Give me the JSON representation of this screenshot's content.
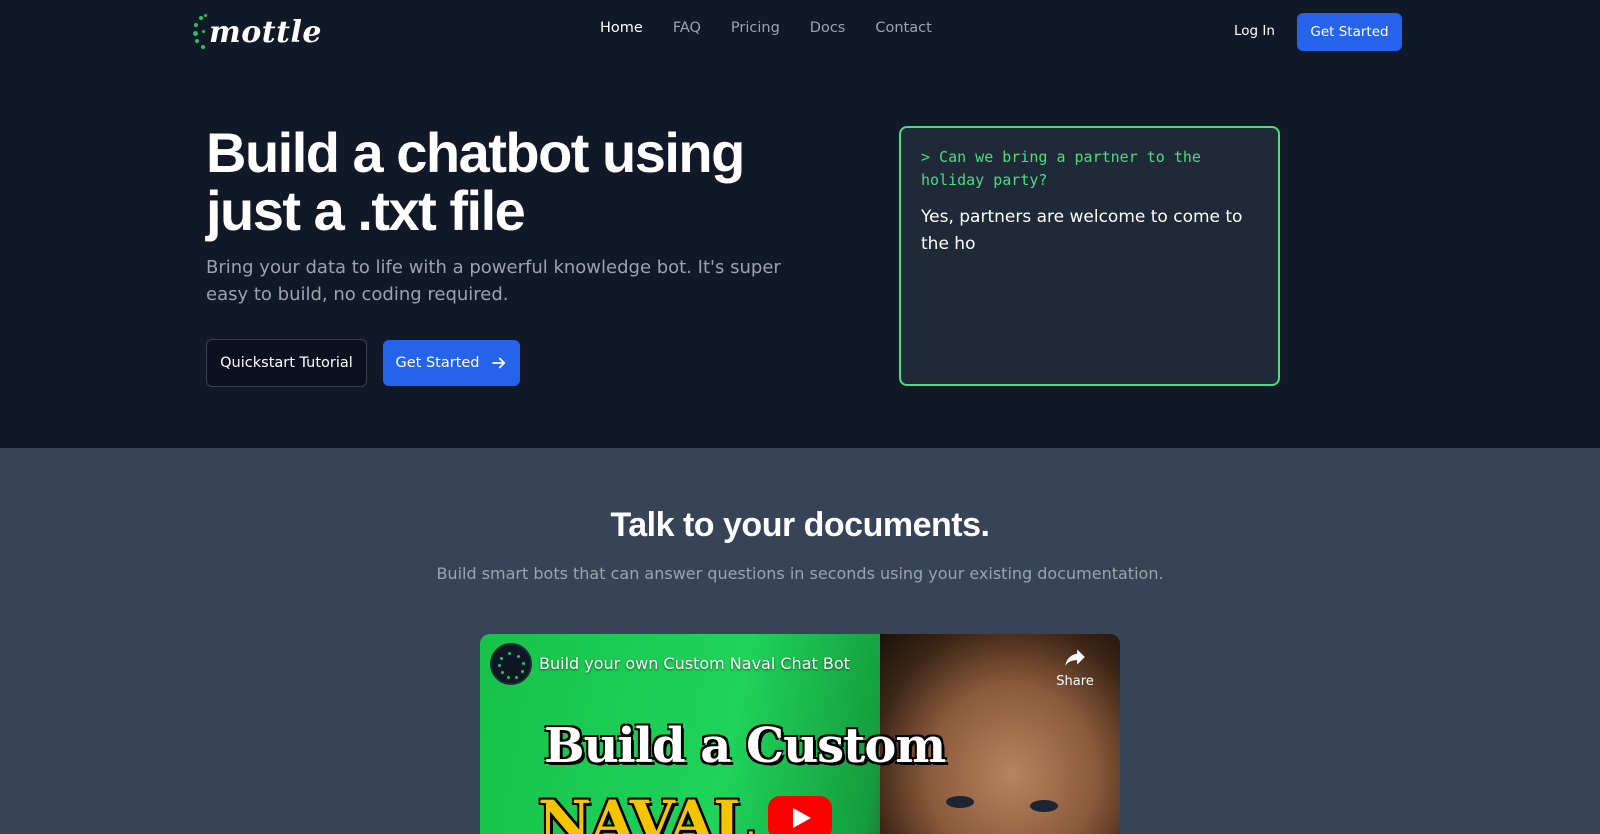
{
  "brand": {
    "name": "mottle",
    "accent": "#22c55e",
    "primary": "#2563eb"
  },
  "nav": {
    "links": [
      "Home",
      "FAQ",
      "Pricing",
      "Docs",
      "Contact"
    ],
    "active": "Home",
    "login": "Log In",
    "cta": "Get Started"
  },
  "hero": {
    "title": "Build a chatbot using just a .txt file",
    "subtitle": "Bring your data to life with a powerful knowledge bot. It's super easy to build, no coding required.",
    "quickstart": "Quickstart Tutorial",
    "get_started": "Get Started",
    "arrow_icon": "arrow-right-icon"
  },
  "chat_demo": {
    "question": "> Can we bring a partner to the holiday party?",
    "answer": "Yes, partners are welcome to come to the ho"
  },
  "section": {
    "title": "Talk to your documents.",
    "subtitle": "Build smart bots that can answer questions in seconds using your existing documentation."
  },
  "video": {
    "title": "Build your own Custom Naval Chat Bot",
    "share": "Share",
    "thumb_line1": "Build a Custom",
    "thumb_line2": "NAVAL"
  }
}
